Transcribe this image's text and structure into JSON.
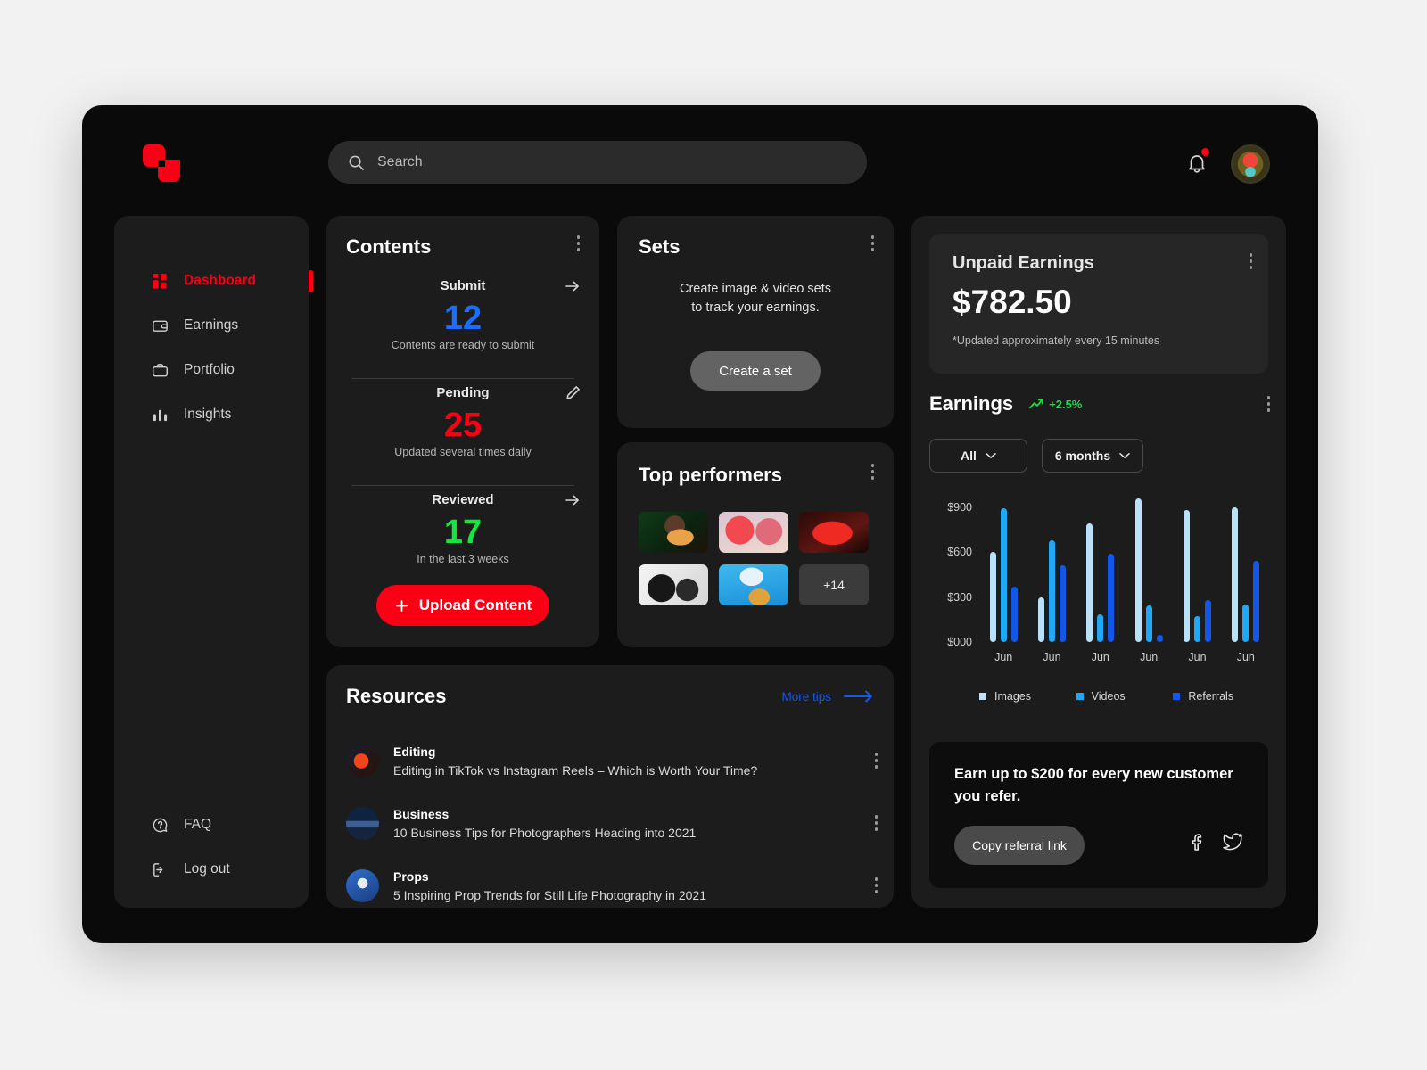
{
  "header": {
    "logo_name": "shutterstock-logo",
    "search": {
      "placeholder": "Search",
      "value": ""
    },
    "bell_label": "Notifications",
    "avatar_label": "User avatar"
  },
  "sidebar": {
    "items": [
      {
        "label": "Dashboard",
        "icon": "grid-icon",
        "active": true
      },
      {
        "label": "Earnings",
        "icon": "wallet-icon",
        "active": false
      },
      {
        "label": "Portfolio",
        "icon": "briefcase-icon",
        "active": false
      },
      {
        "label": "Insights",
        "icon": "bar-chart-icon",
        "active": false
      }
    ],
    "bottom_items": [
      {
        "label": "FAQ",
        "icon": "question-circle-icon"
      },
      {
        "label": "Log out",
        "icon": "logout-icon"
      }
    ]
  },
  "contents": {
    "title": "Contents",
    "stats": [
      {
        "label": "Submit",
        "value": "12",
        "color": "#1a6dff",
        "sub": "Contents are ready to submit",
        "action_icon": "arrow-right-icon"
      },
      {
        "label": "Pending",
        "value": "25",
        "color": "#fb0014",
        "sub": "Updated several times daily",
        "action_icon": "pencil-icon"
      },
      {
        "label": "Reviewed",
        "value": "17",
        "color": "#11e83e",
        "sub": "In the last 3 weeks",
        "action_icon": "arrow-right-icon"
      }
    ],
    "upload_label": "Upload Content"
  },
  "sets": {
    "title": "Sets",
    "description": "Create image & video sets\nto track your earnings.",
    "button_label": "Create a set"
  },
  "performers": {
    "title": "Top performers",
    "more_label": "+14",
    "thumbs": [
      "portrait-green-yellow",
      "two-models-pink",
      "red-light-face",
      "bw-silhouettes",
      "blue-sky-photographer"
    ]
  },
  "resources": {
    "title": "Resources",
    "more_tips_label": "More tips",
    "items": [
      {
        "category": "Editing",
        "description": "Editing in TikTok vs Instagram Reels – Which is Worth Your Time?",
        "thumb": "editing-thumb"
      },
      {
        "category": "Business",
        "description": "10 Business Tips for Photographers Heading into 2021",
        "thumb": "business-thumb"
      },
      {
        "category": "Props",
        "description": "5 Inspiring Prop Trends for Still Life Photography in 2021",
        "thumb": "props-thumb"
      }
    ]
  },
  "unpaid": {
    "title": "Unpaid Earnings",
    "amount": "$782.50",
    "note": "*Updated approximately every 15 minutes"
  },
  "earnings": {
    "title": "Earnings",
    "trend": "+2.5%",
    "trend_color": "#17e04a",
    "filter_type": "All",
    "filter_period": "6 months"
  },
  "referral": {
    "headline": "Earn up to $200 for every new customer you refer.",
    "copy_label": "Copy referral link",
    "socials": [
      "facebook-icon",
      "twitter-icon"
    ]
  },
  "chart_data": {
    "type": "bar",
    "title": "Earnings",
    "xlabel": "",
    "ylabel": "",
    "ylim": [
      0,
      1000
    ],
    "yticks": [
      0,
      300,
      600,
      900
    ],
    "ytick_labels": [
      "$000",
      "$300",
      "$600",
      "$900"
    ],
    "grid": false,
    "legend_position": "bottom",
    "categories": [
      "Jun",
      "Jun",
      "Jun",
      "Jun",
      "Jun",
      "Jun"
    ],
    "series": [
      {
        "name": "Images",
        "color": "#b9e2fa",
        "values": [
          600,
          300,
          790,
          960,
          880,
          900
        ]
      },
      {
        "name": "Videos",
        "color": "#1fa8f5",
        "values": [
          890,
          680,
          185,
          245,
          175,
          250
        ]
      },
      {
        "name": "Referrals",
        "color": "#1357e8",
        "values": [
          370,
          510,
          590,
          50,
          280,
          540
        ]
      }
    ]
  }
}
